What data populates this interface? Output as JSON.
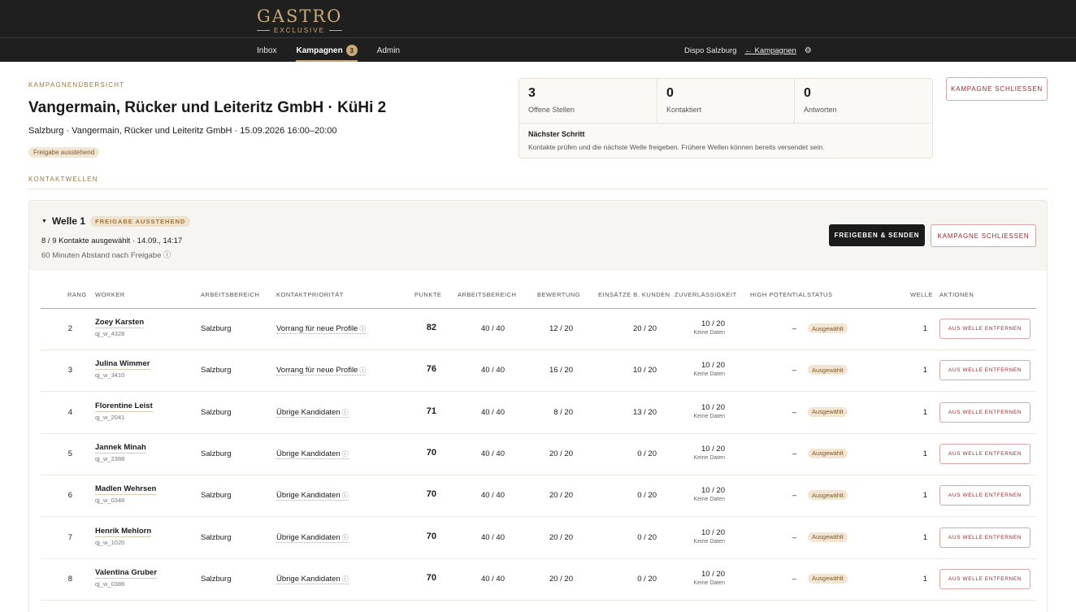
{
  "header": {
    "logo_word": "GASTRO",
    "logo_sub": "EXCLUSIVE",
    "nav": [
      {
        "label": "Inbox"
      },
      {
        "label": "Kampagnen",
        "badge": "3"
      },
      {
        "label": "Admin"
      }
    ],
    "location": "Dispo Salzburg",
    "back_link": "← Kampagnen",
    "gear_icon": "gear-icon"
  },
  "overview": {
    "eyebrow": "KAMPAGNENÜBERSICHT",
    "title": "Vangermain, Rücker und Leiteritz GmbH · KüHi 2",
    "subtitle": "Salzburg · Vangermain, Rücker und Leiteritz GmbH · 15.09.2026 16:00–20:00",
    "status_badge": "Freigabe ausstehend"
  },
  "stats": {
    "items": [
      {
        "value": "3",
        "label": "Offene Stellen"
      },
      {
        "value": "0",
        "label": "Kontaktiert"
      },
      {
        "value": "0",
        "label": "Antworten"
      }
    ],
    "next_step_title": "Nächster Schritt",
    "next_step_text": "Kontakte prüfen und die nächste Welle freigeben. Frühere Wellen können bereits versendet sein."
  },
  "close_campaign_label": "KAMPAGNE SCHLIESSEN",
  "section_label": "KONTAKTWELLEN",
  "wave": {
    "title": "Welle 1",
    "badge": "FREIGABE AUSSTEHEND",
    "meta1": "8 / 9 Kontakte ausgewählt · 14.09., 14:17",
    "meta2": "60 Minuten Abstand nach Freigabe ⓘ",
    "approve_label": "FREIGEBEN & SENDEN",
    "close_label": "KAMPAGNE SCHLIESSEN",
    "columns": [
      "RANG",
      "WORKER",
      "ARBEITSBEREICH",
      "KONTAKTPRIORITÄT",
      "PUNKTE",
      "ARBEITSBEREICH",
      "BEWERTUNG",
      "EINSÄTZE B. KUNDEN",
      "ZUVERLÄSSIGKEIT",
      "HIGH POTENTIAL",
      "STATUS",
      "WELLE",
      "AKTIONEN"
    ],
    "row_action": "AUS WELLE ENTFERNEN",
    "no_data": "Keine Daten",
    "info_glyph": "ⓘ",
    "rows": [
      {
        "rank": "2",
        "name": "Zoey Karsten",
        "id": "qj_w_4328",
        "area": "Salzburg",
        "priority": "Vorrang für neue Profile",
        "points": "82",
        "area_score": "40 / 40",
        "rating": "12 / 20",
        "client": "20 / 20",
        "reliability": "10 / 20",
        "hp": "–",
        "status": "Ausgewählt",
        "wave": "1"
      },
      {
        "rank": "3",
        "name": "Julina Wimmer",
        "id": "qj_w_3410",
        "area": "Salzburg",
        "priority": "Vorrang für neue Profile",
        "points": "76",
        "area_score": "40 / 40",
        "rating": "16 / 20",
        "client": "10 / 20",
        "reliability": "10 / 20",
        "hp": "–",
        "status": "Ausgewählt",
        "wave": "1"
      },
      {
        "rank": "4",
        "name": "Florentine Leist",
        "id": "qj_w_2041",
        "area": "Salzburg",
        "priority": "Übrige Kandidaten",
        "points": "71",
        "area_score": "40 / 40",
        "rating": "8 / 20",
        "client": "13 / 20",
        "reliability": "10 / 20",
        "hp": "–",
        "status": "Ausgewählt",
        "wave": "1"
      },
      {
        "rank": "5",
        "name": "Jannek Minah",
        "id": "qj_w_2388",
        "area": "Salzburg",
        "priority": "Übrige Kandidaten",
        "points": "70",
        "area_score": "40 / 40",
        "rating": "20 / 20",
        "client": "0 / 20",
        "reliability": "10 / 20",
        "hp": "–",
        "status": "Ausgewählt",
        "wave": "1"
      },
      {
        "rank": "6",
        "name": "Madlen Wehrsen",
        "id": "qj_w_0348",
        "area": "Salzburg",
        "priority": "Übrige Kandidaten",
        "points": "70",
        "area_score": "40 / 40",
        "rating": "20 / 20",
        "client": "0 / 20",
        "reliability": "10 / 20",
        "hp": "–",
        "status": "Ausgewählt",
        "wave": "1"
      },
      {
        "rank": "7",
        "name": "Henrik Mehlorn",
        "id": "qj_w_1020",
        "area": "Salzburg",
        "priority": "Übrige Kandidaten",
        "points": "70",
        "area_score": "40 / 40",
        "rating": "20 / 20",
        "client": "0 / 20",
        "reliability": "10 / 20",
        "hp": "–",
        "status": "Ausgewählt",
        "wave": "1"
      },
      {
        "rank": "8",
        "name": "Valentina Gruber",
        "id": "qj_w_0386",
        "area": "Salzburg",
        "priority": "Übrige Kandidaten",
        "points": "70",
        "area_score": "40 / 40",
        "rating": "20 / 20",
        "client": "0 / 20",
        "reliability": "10 / 20",
        "hp": "–",
        "status": "Ausgewählt",
        "wave": "1"
      }
    ]
  }
}
